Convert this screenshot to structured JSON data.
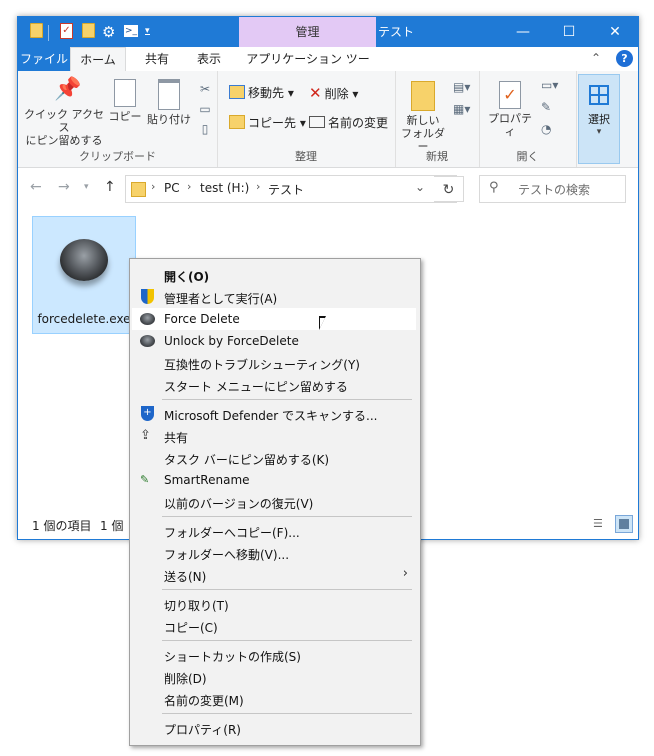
{
  "titlebar": {
    "context_tab": "管理",
    "title": "テスト",
    "minimize_glyph": "—",
    "maximize_glyph": "☐",
    "close_glyph": "✕"
  },
  "tabs": {
    "file": "ファイル",
    "home": "ホーム",
    "share": "共有",
    "view": "表示",
    "app_tools": "アプリケーション ツール"
  },
  "ribbon": {
    "clipboard": {
      "pin_line1": "クイック アクセス",
      "pin_line2": "にピン留めする",
      "copy": "コピー",
      "paste": "貼り付け",
      "label": "クリップボード"
    },
    "organize": {
      "move_to": "移動先",
      "copy_to": "コピー先",
      "delete": "削除",
      "rename": "名前の変更",
      "label": "整理"
    },
    "new": {
      "new_folder_line1": "新しい",
      "new_folder_line2": "フォルダー",
      "label": "新規"
    },
    "open": {
      "properties": "プロパティ",
      "label": "開く"
    },
    "select": {
      "select": "選択"
    }
  },
  "address": {
    "crumbs": [
      "PC",
      "test (H:)",
      "テスト"
    ],
    "search_placeholder": "テストの検索"
  },
  "file": {
    "name": "forcedelete.exe"
  },
  "status": {
    "item_count": "1 個の項目",
    "selected_partial": "1 個"
  },
  "context_menu": {
    "items": [
      "開く(O)",
      "管理者として実行(A)",
      "Force Delete",
      "Unlock by ForceDelete",
      "互換性のトラブルシューティング(Y)",
      "スタート メニューにピン留めする",
      "Microsoft Defender でスキャンする...",
      "共有",
      "タスク バーにピン留めする(K)",
      "SmartRename",
      "以前のバージョンの復元(V)",
      "フォルダーへコピー(F)...",
      "フォルダーへ移動(V)...",
      "送る(N)",
      "切り取り(T)",
      "コピー(C)",
      "ショートカットの作成(S)",
      "削除(D)",
      "名前の変更(M)",
      "プロパティ(R)"
    ]
  },
  "colors": {
    "titlebar": "#1f7ad6",
    "context_tab": "#e3c9f5",
    "selection": "#cce8ff",
    "menu_bg": "#f2f2f2"
  }
}
